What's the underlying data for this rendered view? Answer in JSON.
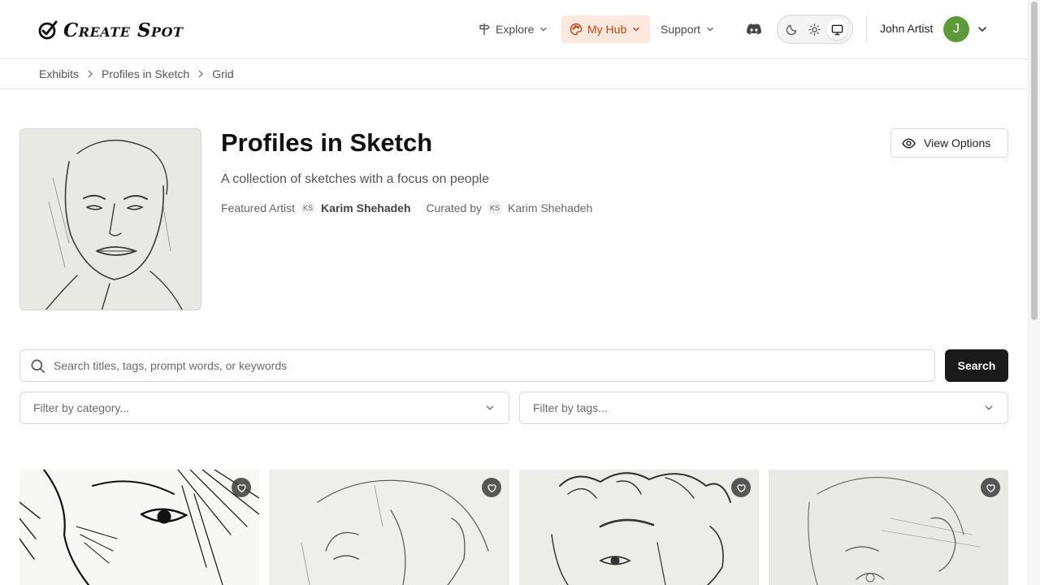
{
  "brand": {
    "name": "Create Spot"
  },
  "nav": {
    "explore": "Explore",
    "my_hub": "My Hub",
    "support": "Support"
  },
  "user": {
    "name": "John Artist",
    "initial": "J"
  },
  "breadcrumb": [
    "Exhibits",
    "Profiles in Sketch",
    "Grid"
  ],
  "exhibit": {
    "title": "Profiles in Sketch",
    "description": "A collection of sketches with a focus on people",
    "featured_label": "Featured Artist",
    "featured_initials": "KS",
    "featured_name": "Karim Shehadeh",
    "curated_label": "Curated by",
    "curator_initials": "KS",
    "curator_name": "Karim Shehadeh",
    "view_options_label": "View Options"
  },
  "search": {
    "placeholder": "Search titles, tags, prompt words, or keywords",
    "value": "",
    "button_label": "Search"
  },
  "filters": {
    "category_placeholder": "Filter by category...",
    "tags_placeholder": "Filter by tags..."
  },
  "colors": {
    "accent": "#b3461a",
    "accent_bg": "#fde8de",
    "avatar": "#5f9a3a",
    "primary_button": "#1a1a1a"
  },
  "icons": [
    "signpost-icon",
    "palette-icon",
    "chevron-down-icon",
    "discord-icon",
    "moon-icon",
    "sun-icon",
    "monitor-icon",
    "chevron-right-icon",
    "eye-icon",
    "search-icon",
    "heart-icon"
  ]
}
